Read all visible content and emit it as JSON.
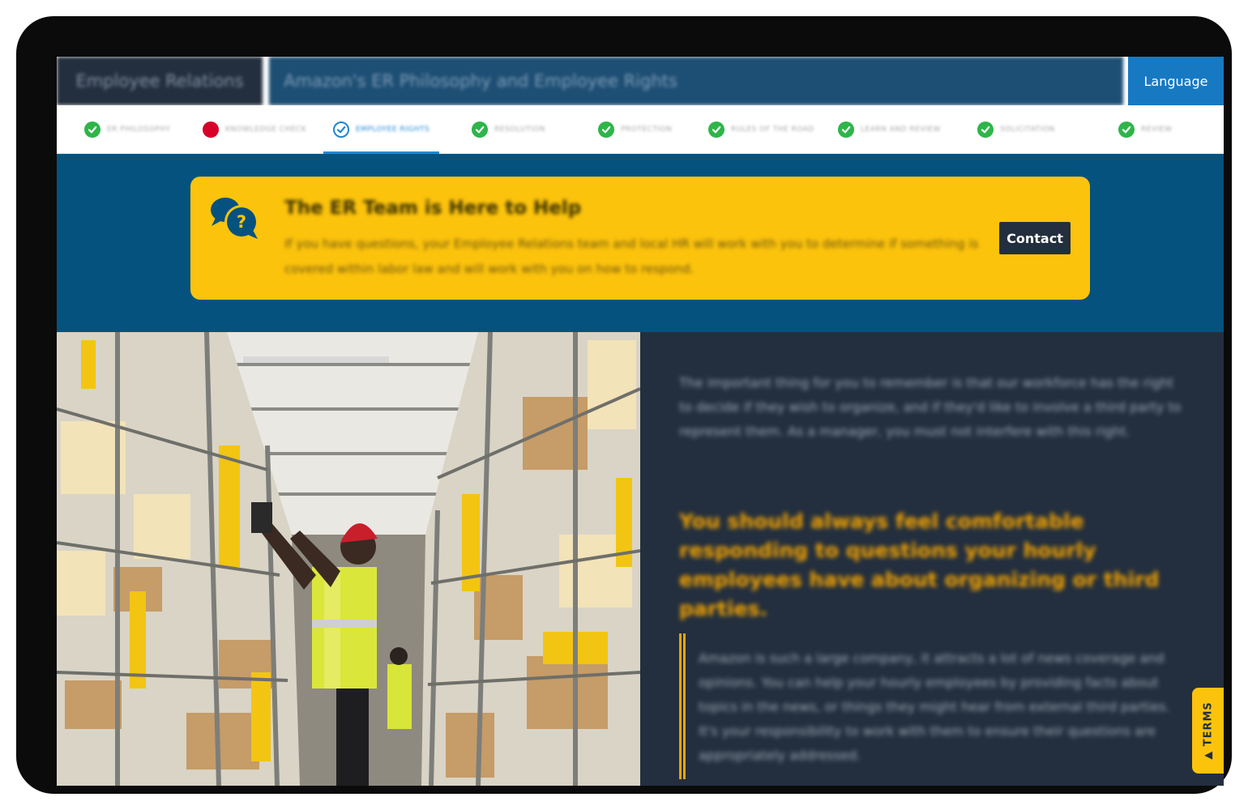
{
  "header": {
    "course_title": "Employee Relations",
    "module_title": "Amazon's ER Philosophy and Employee Rights",
    "language_label": "Language"
  },
  "tabs": [
    {
      "label": "ER PHILOSOPHY",
      "status": "complete"
    },
    {
      "label": "KNOWLEDGE CHECK",
      "status": "incorrect"
    },
    {
      "label": "EMPLOYEE RIGHTS",
      "status": "current"
    },
    {
      "label": "RESOLUTION",
      "status": "complete"
    },
    {
      "label": "PROTECTION",
      "status": "complete"
    },
    {
      "label": "RULES OF THE ROAD",
      "status": "complete"
    },
    {
      "label": "LEARN AND REVIEW",
      "status": "complete"
    },
    {
      "label": "SOLICITATION",
      "status": "complete"
    },
    {
      "label": "REVIEW",
      "status": "complete"
    }
  ],
  "help": {
    "icon": "chat-question-icon",
    "title": "The ER Team is Here to Help",
    "body": "If you have questions, your Employee Relations team and local HR will work with you to determine if something is covered within labor law and will work with you on how to respond.",
    "contact_label": "Contact"
  },
  "content": {
    "paragraph": "The important thing for you to remember is that our workforce has the right to decide if they wish to organize, and if they'd like to involve a third party to represent them. As a manager, you must not interfere with this right.",
    "emphasis": "You should always feel comfortable responding to questions your hourly employees have about organizing or third parties.",
    "quote": "Amazon is such a large company, it attracts a lot of news coverage and opinions. You can help your hourly employees by providing facts about topics in the news, or things they might hear from external third parties. It's your responsibility to work with them to ensure their questions are appropriately addressed."
  },
  "terms_label": "TERMS",
  "colors": {
    "navy": "#232f3e",
    "band_blue": "#05527e",
    "accent_yellow": "#fcc30d",
    "emphasis_orange": "#f4a300",
    "check_green": "#2eb54a",
    "incorrect_red": "#d6002a",
    "active_blue": "#1e88d4"
  }
}
